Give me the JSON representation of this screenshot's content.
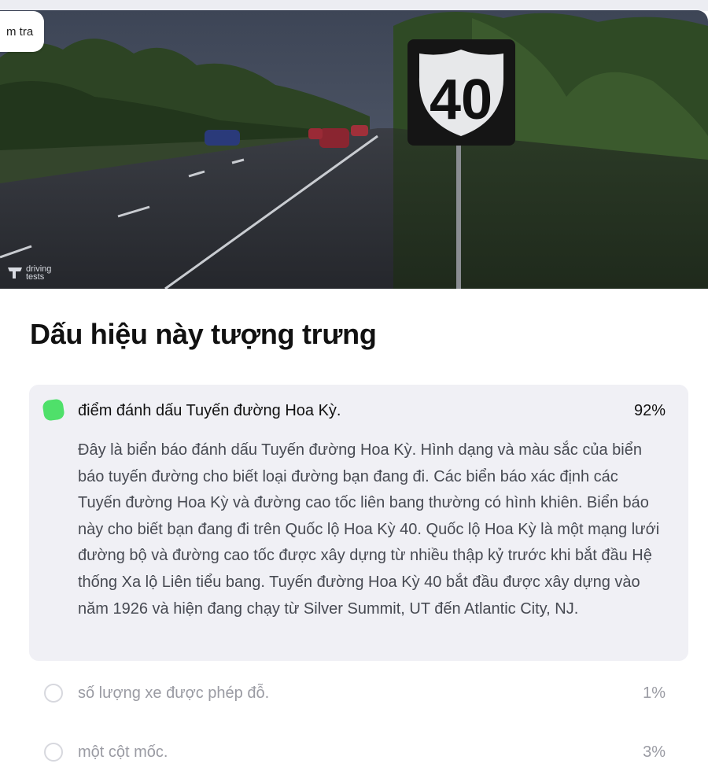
{
  "header": {
    "tab_chip_label": "m tra"
  },
  "hero": {
    "sign_number": "40",
    "watermark_line1": "driving",
    "watermark_line2": "tests"
  },
  "question": {
    "title": "Dấu hiệu này tượng trưng"
  },
  "answers": [
    {
      "text": "điểm đánh dấu Tuyến đường Hoa Kỳ.",
      "percent": "92%",
      "correct": true,
      "explanation": "Đây là biển báo đánh dấu Tuyến đường Hoa Kỳ. Hình dạng và màu sắc của biển báo tuyến đường cho biết loại đường bạn đang đi. Các biển báo xác định các Tuyến đường Hoa Kỳ và đường cao tốc liên bang thường có hình khiên. Biển báo này cho biết bạn đang đi trên Quốc lộ Hoa Kỳ 40. Quốc lộ Hoa Kỳ là một mạng lưới đường bộ và đường cao tốc được xây dựng từ nhiều thập kỷ trước khi bắt đầu Hệ thống Xa lộ Liên tiểu bang. Tuyến đường Hoa Kỳ 40 bắt đầu được xây dựng vào năm 1926 và hiện đang chạy từ Silver Summit, UT đến Atlantic City, NJ."
    },
    {
      "text": "số lượng xe được phép đỗ.",
      "percent": "1%",
      "correct": false
    },
    {
      "text": "một cột mốc.",
      "percent": "3%",
      "correct": false
    }
  ],
  "colors": {
    "correct_indicator": "#4fe06a",
    "card_background": "#f0f0f5",
    "muted_text": "#9a9ba3"
  }
}
